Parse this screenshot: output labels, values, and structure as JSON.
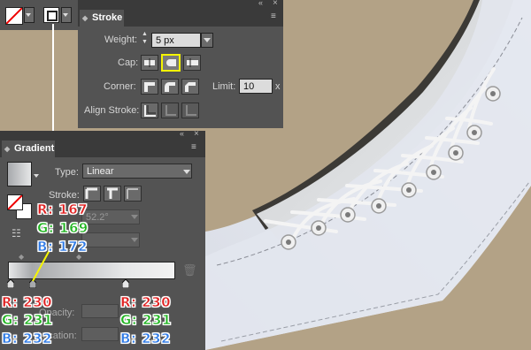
{
  "colors": {
    "background": "#b3a286",
    "panel": "#535353",
    "highlight": "#f5f500",
    "red": "#e02020",
    "green": "#22b522",
    "blue": "#2e7ae6"
  },
  "stroke_panel": {
    "title": "Stroke",
    "weight_label": "Weight:",
    "weight_value": "5 px",
    "cap_label": "Cap:",
    "corner_label": "Corner:",
    "limit_label": "Limit:",
    "limit_value": "10",
    "limit_unit": "x",
    "align_label": "Align Stroke:"
  },
  "gradient_panel": {
    "title": "Gradient",
    "type_label": "Type:",
    "type_value": "Linear",
    "stroke_label": "Stroke:",
    "angle_value": "52.2°",
    "opacity_label": "Opacity:",
    "location_label": "Location:"
  },
  "annotations": {
    "left_stop": {
      "r": "R: 167",
      "g": "G: 169",
      "b": "B: 172"
    },
    "bottom_left": {
      "r": "R: 230",
      "g": "G: 231",
      "b": "B: 232"
    },
    "bottom_right": {
      "r": "R: 230",
      "g": "G: 231",
      "b": "B: 232"
    }
  }
}
